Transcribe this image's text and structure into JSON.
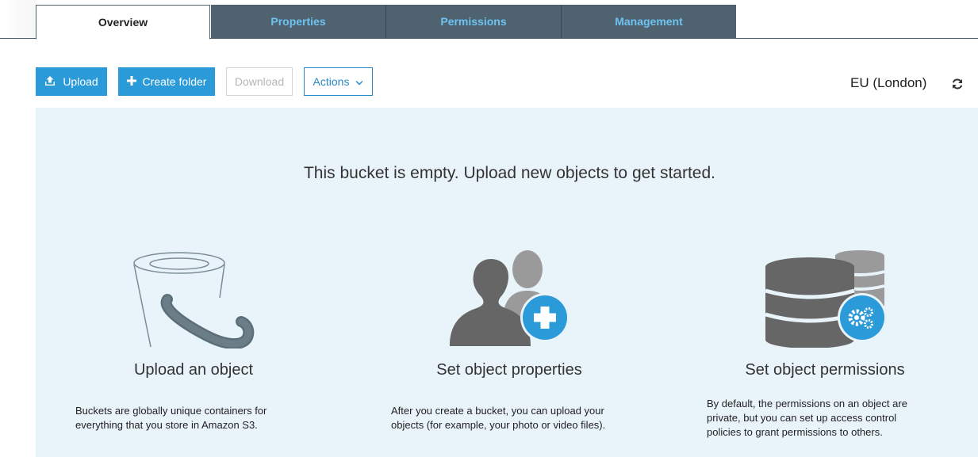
{
  "tabs": [
    {
      "label": "Overview",
      "active": true
    },
    {
      "label": "Properties",
      "active": false
    },
    {
      "label": "Permissions",
      "active": false
    },
    {
      "label": "Management",
      "active": false
    }
  ],
  "toolbar": {
    "upload_label": "Upload",
    "create_folder_label": "Create folder",
    "download_label": "Download",
    "actions_label": "Actions",
    "region": "EU (London)"
  },
  "empty_state": {
    "message": "This bucket is empty. Upload new objects to get started.",
    "cards": [
      {
        "title": "Upload an object",
        "lines": [
          "Buckets are globally unique containers for",
          "everything that you store in Amazon S3."
        ],
        "icon": "bucket-icon"
      },
      {
        "title": "Set object properties",
        "lines": [
          "After you create a bucket, you can upload your",
          "objects (for example, your photo or video files)."
        ],
        "icon": "users-add-icon"
      },
      {
        "title": "Set object permissions",
        "lines": [
          "By default, the permissions on an object are",
          "private, but you can set up access control",
          "policies to grant permissions to others."
        ],
        "icon": "database-gear-icon"
      }
    ]
  },
  "colors": {
    "accent": "#2b9ad8",
    "tab_inactive_bg": "#4f6270",
    "tab_inactive_text": "#6ec3f0",
    "panel_bg": "#e9f3fa",
    "illustration_gray": "#6b6b6b"
  }
}
